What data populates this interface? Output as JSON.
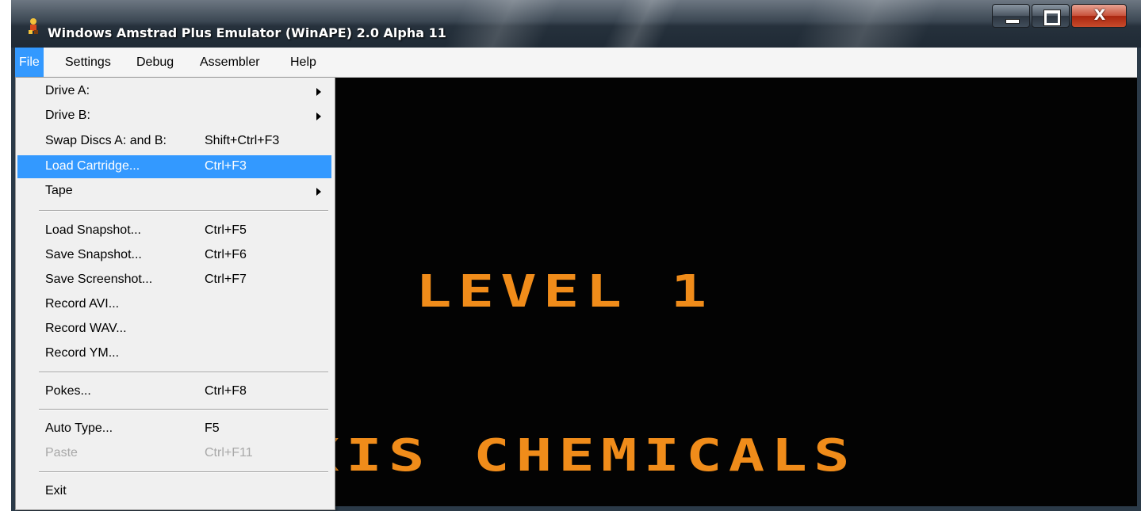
{
  "window": {
    "title": "Windows Amstrad Plus Emulator (WinAPE) 2.0 Alpha 11",
    "close_glyph": "X"
  },
  "menubar": {
    "items": [
      {
        "label": "File"
      },
      {
        "label": "Settings"
      },
      {
        "label": "Debug"
      },
      {
        "label": "Assembler"
      },
      {
        "label": "Help"
      }
    ]
  },
  "file_menu": {
    "items": [
      {
        "label": "Drive A:",
        "shortcut": "",
        "submenu": true
      },
      {
        "label": "Drive B:",
        "shortcut": "",
        "submenu": true
      },
      {
        "label": "Swap Discs A: and B:",
        "shortcut": "Shift+Ctrl+F3"
      },
      {
        "label": "Load Cartridge...",
        "shortcut": "Ctrl+F3",
        "highlighted": true
      },
      {
        "label": "Tape",
        "shortcut": "",
        "submenu": true
      },
      {
        "label": "Load Snapshot...",
        "shortcut": "Ctrl+F5"
      },
      {
        "label": "Save Snapshot...",
        "shortcut": "Ctrl+F6"
      },
      {
        "label": "Save Screenshot...",
        "shortcut": "Ctrl+F7"
      },
      {
        "label": "Record AVI...",
        "shortcut": ""
      },
      {
        "label": "Record WAV...",
        "shortcut": ""
      },
      {
        "label": "Record YM...",
        "shortcut": ""
      },
      {
        "label": "Pokes...",
        "shortcut": "Ctrl+F8"
      },
      {
        "label": "Auto Type...",
        "shortcut": "F5"
      },
      {
        "label": "Paste",
        "shortcut": "Ctrl+F11",
        "disabled": true
      },
      {
        "label": "Exit",
        "shortcut": ""
      }
    ]
  },
  "emulator_screen": {
    "line1": "LEVEL 1",
    "line2": "AXIS CHEMICALS",
    "text_color": "#f08c1a"
  },
  "colors": {
    "highlight": "#3399ff",
    "screen_bg": "#030303"
  }
}
